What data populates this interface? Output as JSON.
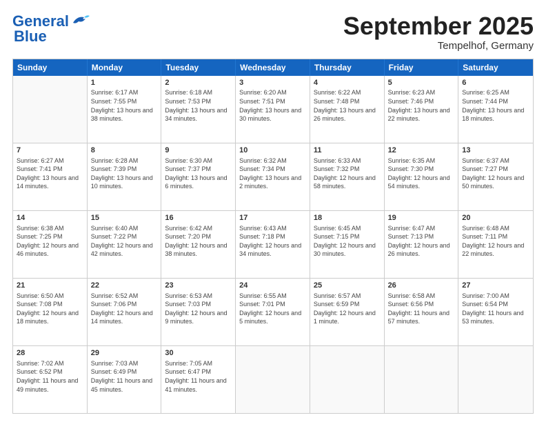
{
  "header": {
    "logo_line1": "General",
    "logo_line2": "Blue",
    "month": "September 2025",
    "location": "Tempelhof, Germany"
  },
  "weekdays": [
    "Sunday",
    "Monday",
    "Tuesday",
    "Wednesday",
    "Thursday",
    "Friday",
    "Saturday"
  ],
  "rows": [
    [
      {
        "day": "",
        "empty": true
      },
      {
        "day": "1",
        "sunrise": "Sunrise: 6:17 AM",
        "sunset": "Sunset: 7:55 PM",
        "daylight": "Daylight: 13 hours and 38 minutes."
      },
      {
        "day": "2",
        "sunrise": "Sunrise: 6:18 AM",
        "sunset": "Sunset: 7:53 PM",
        "daylight": "Daylight: 13 hours and 34 minutes."
      },
      {
        "day": "3",
        "sunrise": "Sunrise: 6:20 AM",
        "sunset": "Sunset: 7:51 PM",
        "daylight": "Daylight: 13 hours and 30 minutes."
      },
      {
        "day": "4",
        "sunrise": "Sunrise: 6:22 AM",
        "sunset": "Sunset: 7:48 PM",
        "daylight": "Daylight: 13 hours and 26 minutes."
      },
      {
        "day": "5",
        "sunrise": "Sunrise: 6:23 AM",
        "sunset": "Sunset: 7:46 PM",
        "daylight": "Daylight: 13 hours and 22 minutes."
      },
      {
        "day": "6",
        "sunrise": "Sunrise: 6:25 AM",
        "sunset": "Sunset: 7:44 PM",
        "daylight": "Daylight: 13 hours and 18 minutes."
      }
    ],
    [
      {
        "day": "7",
        "sunrise": "Sunrise: 6:27 AM",
        "sunset": "Sunset: 7:41 PM",
        "daylight": "Daylight: 13 hours and 14 minutes."
      },
      {
        "day": "8",
        "sunrise": "Sunrise: 6:28 AM",
        "sunset": "Sunset: 7:39 PM",
        "daylight": "Daylight: 13 hours and 10 minutes."
      },
      {
        "day": "9",
        "sunrise": "Sunrise: 6:30 AM",
        "sunset": "Sunset: 7:37 PM",
        "daylight": "Daylight: 13 hours and 6 minutes."
      },
      {
        "day": "10",
        "sunrise": "Sunrise: 6:32 AM",
        "sunset": "Sunset: 7:34 PM",
        "daylight": "Daylight: 13 hours and 2 minutes."
      },
      {
        "day": "11",
        "sunrise": "Sunrise: 6:33 AM",
        "sunset": "Sunset: 7:32 PM",
        "daylight": "Daylight: 12 hours and 58 minutes."
      },
      {
        "day": "12",
        "sunrise": "Sunrise: 6:35 AM",
        "sunset": "Sunset: 7:30 PM",
        "daylight": "Daylight: 12 hours and 54 minutes."
      },
      {
        "day": "13",
        "sunrise": "Sunrise: 6:37 AM",
        "sunset": "Sunset: 7:27 PM",
        "daylight": "Daylight: 12 hours and 50 minutes."
      }
    ],
    [
      {
        "day": "14",
        "sunrise": "Sunrise: 6:38 AM",
        "sunset": "Sunset: 7:25 PM",
        "daylight": "Daylight: 12 hours and 46 minutes."
      },
      {
        "day": "15",
        "sunrise": "Sunrise: 6:40 AM",
        "sunset": "Sunset: 7:22 PM",
        "daylight": "Daylight: 12 hours and 42 minutes."
      },
      {
        "day": "16",
        "sunrise": "Sunrise: 6:42 AM",
        "sunset": "Sunset: 7:20 PM",
        "daylight": "Daylight: 12 hours and 38 minutes."
      },
      {
        "day": "17",
        "sunrise": "Sunrise: 6:43 AM",
        "sunset": "Sunset: 7:18 PM",
        "daylight": "Daylight: 12 hours and 34 minutes."
      },
      {
        "day": "18",
        "sunrise": "Sunrise: 6:45 AM",
        "sunset": "Sunset: 7:15 PM",
        "daylight": "Daylight: 12 hours and 30 minutes."
      },
      {
        "day": "19",
        "sunrise": "Sunrise: 6:47 AM",
        "sunset": "Sunset: 7:13 PM",
        "daylight": "Daylight: 12 hours and 26 minutes."
      },
      {
        "day": "20",
        "sunrise": "Sunrise: 6:48 AM",
        "sunset": "Sunset: 7:11 PM",
        "daylight": "Daylight: 12 hours and 22 minutes."
      }
    ],
    [
      {
        "day": "21",
        "sunrise": "Sunrise: 6:50 AM",
        "sunset": "Sunset: 7:08 PM",
        "daylight": "Daylight: 12 hours and 18 minutes."
      },
      {
        "day": "22",
        "sunrise": "Sunrise: 6:52 AM",
        "sunset": "Sunset: 7:06 PM",
        "daylight": "Daylight: 12 hours and 14 minutes."
      },
      {
        "day": "23",
        "sunrise": "Sunrise: 6:53 AM",
        "sunset": "Sunset: 7:03 PM",
        "daylight": "Daylight: 12 hours and 9 minutes."
      },
      {
        "day": "24",
        "sunrise": "Sunrise: 6:55 AM",
        "sunset": "Sunset: 7:01 PM",
        "daylight": "Daylight: 12 hours and 5 minutes."
      },
      {
        "day": "25",
        "sunrise": "Sunrise: 6:57 AM",
        "sunset": "Sunset: 6:59 PM",
        "daylight": "Daylight: 12 hours and 1 minute."
      },
      {
        "day": "26",
        "sunrise": "Sunrise: 6:58 AM",
        "sunset": "Sunset: 6:56 PM",
        "daylight": "Daylight: 11 hours and 57 minutes."
      },
      {
        "day": "27",
        "sunrise": "Sunrise: 7:00 AM",
        "sunset": "Sunset: 6:54 PM",
        "daylight": "Daylight: 11 hours and 53 minutes."
      }
    ],
    [
      {
        "day": "28",
        "sunrise": "Sunrise: 7:02 AM",
        "sunset": "Sunset: 6:52 PM",
        "daylight": "Daylight: 11 hours and 49 minutes."
      },
      {
        "day": "29",
        "sunrise": "Sunrise: 7:03 AM",
        "sunset": "Sunset: 6:49 PM",
        "daylight": "Daylight: 11 hours and 45 minutes."
      },
      {
        "day": "30",
        "sunrise": "Sunrise: 7:05 AM",
        "sunset": "Sunset: 6:47 PM",
        "daylight": "Daylight: 11 hours and 41 minutes."
      },
      {
        "day": "",
        "empty": true
      },
      {
        "day": "",
        "empty": true
      },
      {
        "day": "",
        "empty": true
      },
      {
        "day": "",
        "empty": true
      }
    ]
  ]
}
